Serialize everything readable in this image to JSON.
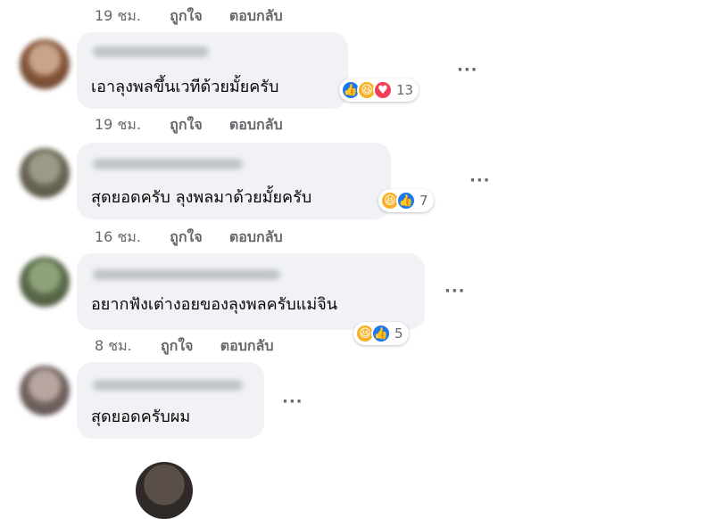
{
  "comments": [
    {
      "text": "",
      "time": "19 ชม.",
      "like": "ถูกใจ",
      "reply": "ตอบกลับ"
    },
    {
      "text": "เอาลุงพลขึ้นเวทีด้วยมั้ยครับ",
      "time": "19 ชม.",
      "like": "ถูกใจ",
      "reply": "ตอบกลับ",
      "reactions": [
        "like",
        "haha",
        "love"
      ],
      "count": "13"
    },
    {
      "text": "สุดยอดครับ ลุงพลมาด้วยมั้ยครับ",
      "time": "16 ชม.",
      "like": "ถูกใจ",
      "reply": "ตอบกลับ",
      "reactions": [
        "haha",
        "like"
      ],
      "count": "7"
    },
    {
      "text": "อยากฟังเต่างอยของลุงพลครับแม่จิน",
      "time": "8 ชม.",
      "like": "ถูกใจ",
      "reply": "ตอบกลับ",
      "reactions": [
        "haha",
        "like"
      ],
      "count": "5"
    },
    {
      "text": "สุดยอดครับผม"
    }
  ],
  "more_label": "···",
  "icons": {
    "like": "👍",
    "haha": "😆",
    "love": "♥"
  },
  "colors": {
    "bubble": "#f0f2f5",
    "meta": "#65676b",
    "like": "#1877f2",
    "haha": "#f7b125",
    "love": "#f33e58"
  }
}
